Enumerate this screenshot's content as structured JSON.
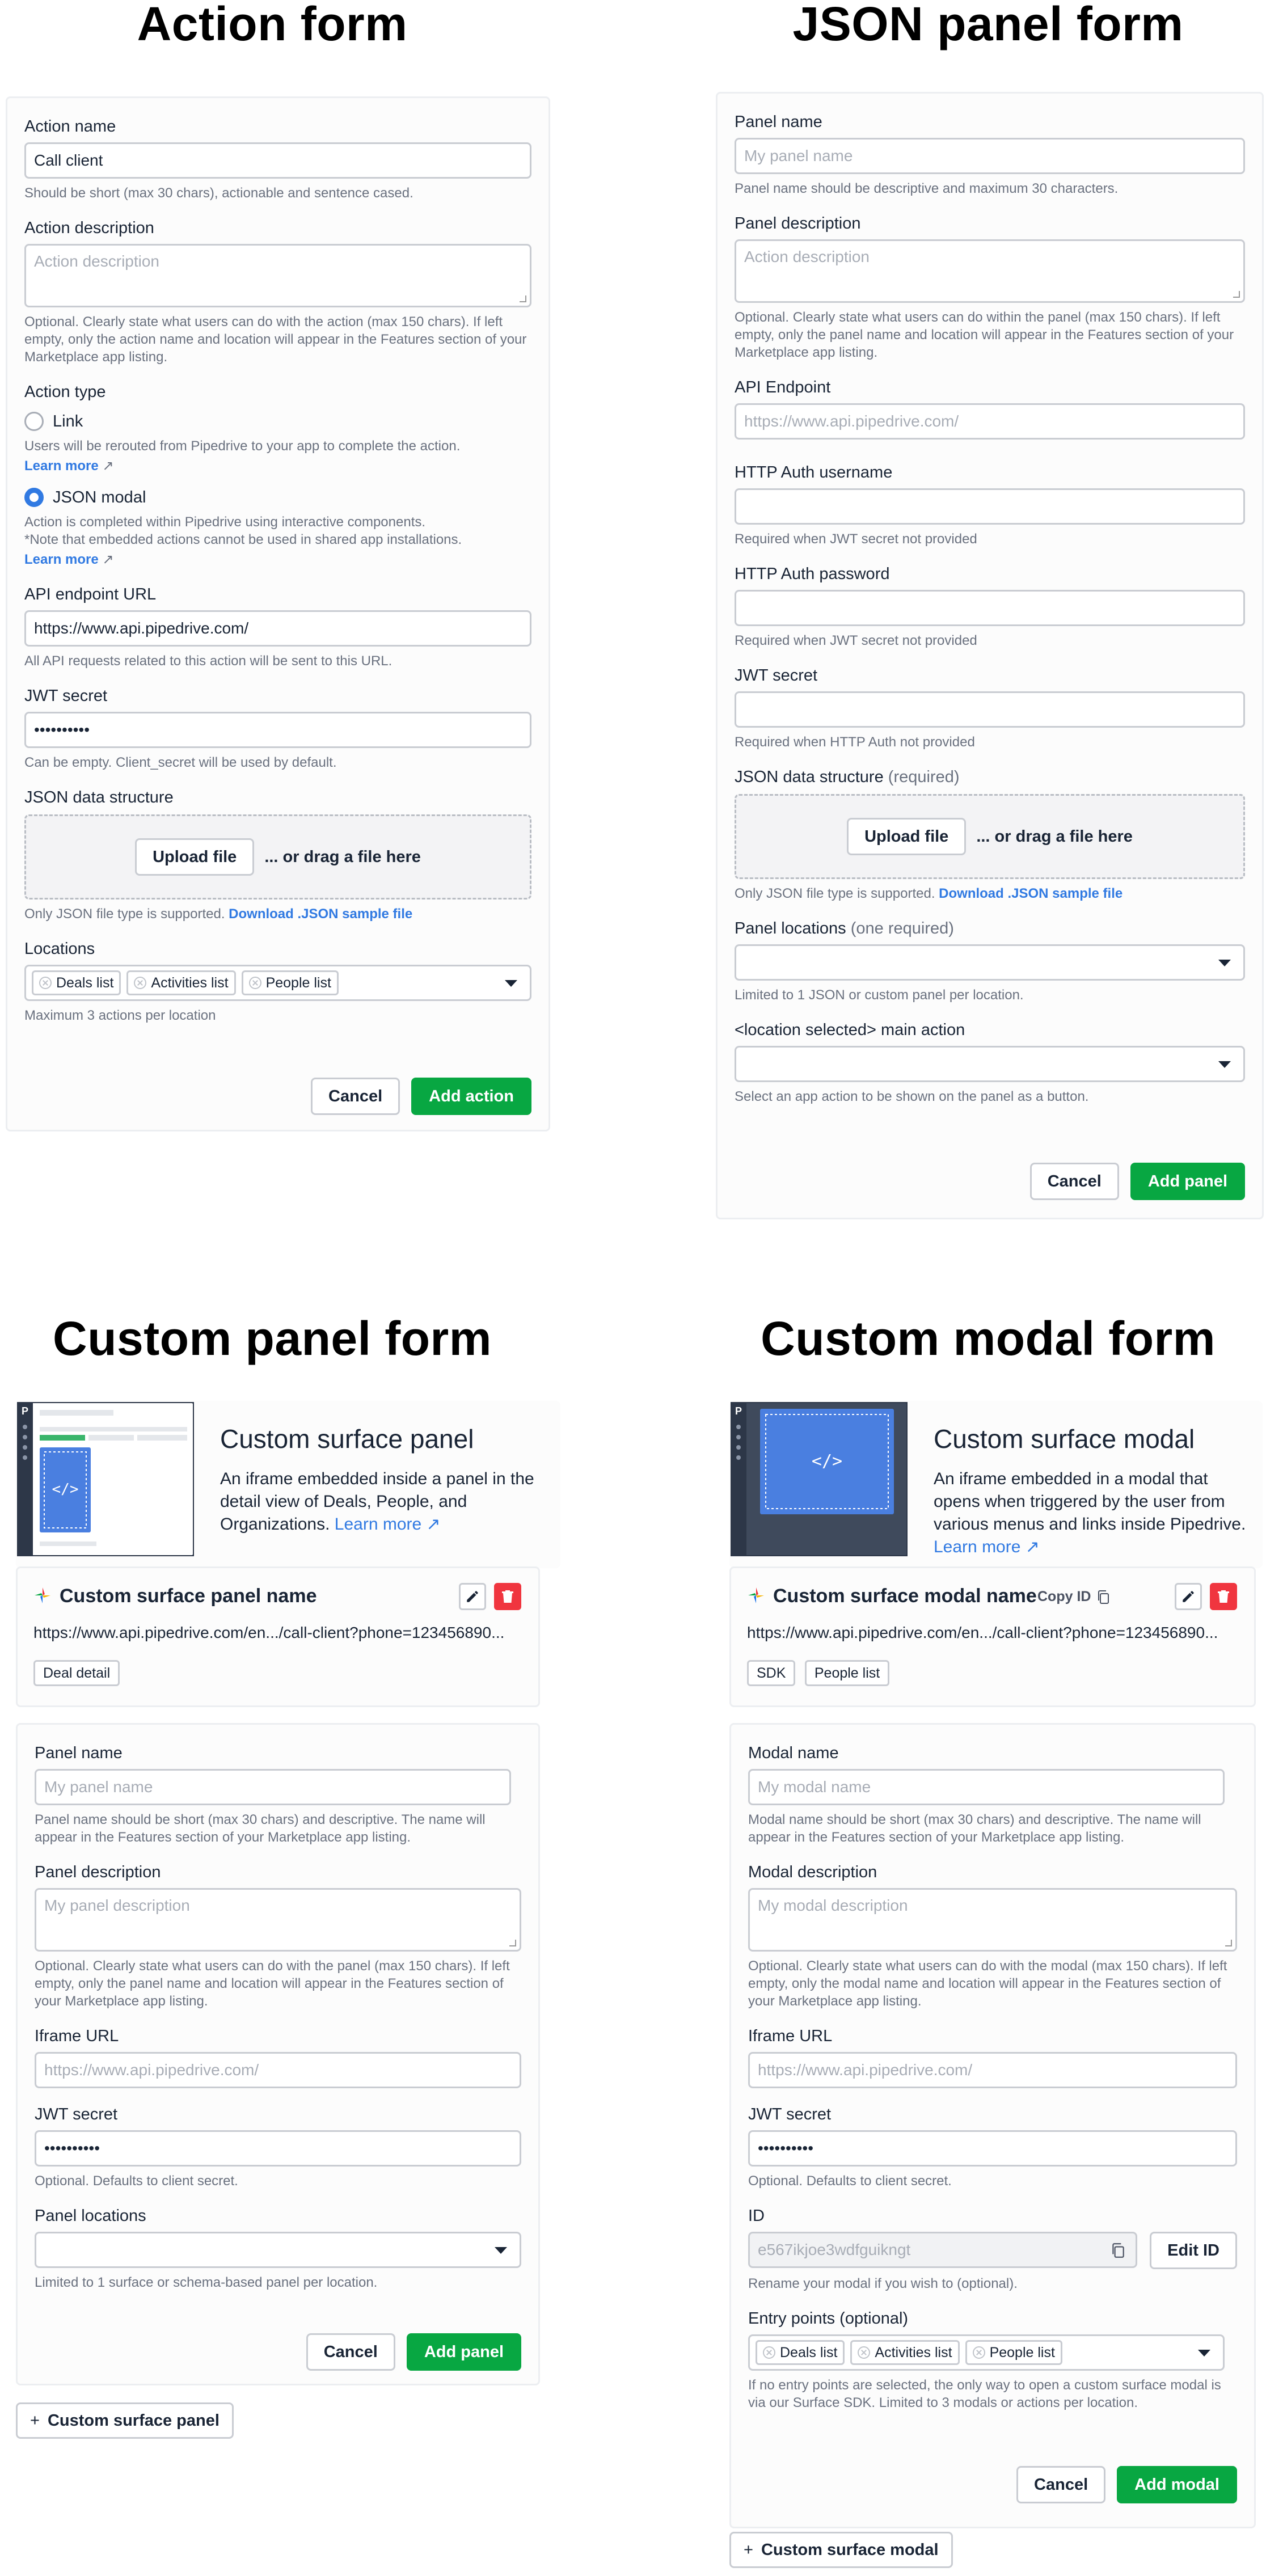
{
  "action_form": {
    "title": "Action form",
    "name_label": "Action name",
    "name_value": "Call client",
    "name_help": "Should be short (max 30 chars), actionable and sentence cased.",
    "desc_label": "Action description",
    "desc_placeholder": "Action description",
    "desc_help": "Optional. Clearly state what users can do with the action (max 150 chars). If left empty, only the action name and location will appear in the Features section of your Marketplace app listing.",
    "type_label": "Action type",
    "link_option": "Link",
    "link_help": "Users will be rerouted from Pipedrive to your app to complete the action.",
    "learn_more": "Learn more",
    "json_option": "JSON modal",
    "json_help": "Action is completed within Pipedrive using interactive components.",
    "json_note": "*Note that embedded actions cannot be used in shared app installations.",
    "api_label": "API endpoint URL",
    "api_value": "https://www.api.pipedrive.com/",
    "api_help": "All API requests related to this action will be sent to this URL.",
    "jwt_label": "JWT secret",
    "jwt_value": "••••••••••",
    "jwt_help": "Can be empty. Client_secret will be used by default.",
    "json_label": "JSON data structure",
    "upload": "Upload file",
    "drag": "... or drag a file here",
    "json_support": "Only JSON file type is supported.",
    "download": "Download .JSON sample file",
    "locations_label": "Locations",
    "locations": [
      "Deals list",
      "Activities list",
      "People list"
    ],
    "locations_help": "Maximum 3 actions per location",
    "cancel": "Cancel",
    "submit": "Add action"
  },
  "json_panel_form": {
    "title": "JSON panel form",
    "name_label": "Panel name",
    "name_placeholder": "My panel name",
    "name_help": "Panel name should be descriptive and maximum 30 characters.",
    "desc_label": "Panel description",
    "desc_placeholder": "Action description",
    "desc_help": "Optional. Clearly state what users can do within the panel (max 150 chars). If left empty, only the panel name and location will appear in the Features section of your Marketplace app listing.",
    "api_label": "API Endpoint",
    "api_placeholder": "https://www.api.pipedrive.com/",
    "user_label": "HTTP Auth username",
    "user_help": "Required when JWT secret not provided",
    "pass_label": "HTTP Auth password",
    "pass_help": "Required when JWT secret not provided",
    "jwt_label": "JWT secret",
    "jwt_help": "Required when HTTP Auth not provided",
    "json_label": "JSON data structure",
    "json_req": "(required)",
    "upload": "Upload file",
    "drag": "... or drag a file here",
    "json_support": "Only JSON file type is supported.",
    "download": "Download .JSON sample file",
    "loc_label": "Panel locations",
    "loc_req": "(one required)",
    "loc_help": "Limited to 1 JSON or custom panel per location.",
    "main_label": "<location selected> main action",
    "main_help": "Select an app action to be shown on the panel as a button.",
    "cancel": "Cancel",
    "submit": "Add panel"
  },
  "custom_panel_form": {
    "title": "Custom panel form",
    "surface_title": "Custom surface panel",
    "surface_desc": "An iframe embedded inside a panel in the detail view of Deals, People, and Organizations.",
    "learn_more": "Learn more",
    "card_name": "Custom surface panel name",
    "card_url": "https://www.api.pipedrive.com/en.../call-client?phone=123456890...",
    "card_tags": [
      "Deal detail"
    ],
    "name_label": "Panel name",
    "name_placeholder": "My panel name",
    "name_help": "Panel name should be short (max 30 chars) and descriptive. The name will appear in the Features section of your Marketplace app listing.",
    "desc_label": "Panel description",
    "desc_placeholder": "My panel description",
    "desc_help": "Optional. Clearly state what users can do with the panel (max 150 chars). If left empty, only the panel name and location will appear in the Features section of your Marketplace app listing.",
    "iframe_label": "Iframe URL",
    "iframe_placeholder": "https://www.api.pipedrive.com/",
    "jwt_label": "JWT secret",
    "jwt_value": "••••••••••",
    "jwt_help": "Optional. Defaults to client secret.",
    "loc_label": "Panel locations",
    "loc_help": "Limited to 1 surface or schema-based panel per location.",
    "cancel": "Cancel",
    "submit": "Add panel",
    "add_more": "Custom surface panel"
  },
  "custom_modal_form": {
    "title": "Custom modal form",
    "surface_title": "Custom surface modal",
    "surface_desc": "An iframe embedded in a modal that opens when triggered by the user from various menus and links inside Pipedrive.",
    "learn_more": "Learn more",
    "card_name": "Custom surface modal name",
    "copy_id": "Copy ID",
    "card_url": "https://www.api.pipedrive.com/en.../call-client?phone=123456890...",
    "card_tags": [
      "SDK",
      "People list"
    ],
    "name_label": "Modal name",
    "name_placeholder": "My modal name",
    "name_help": "Modal name should be short (max 30 chars) and descriptive. The name will appear in the Features section of your Marketplace app listing.",
    "desc_label": "Modal description",
    "desc_placeholder": "My modal description",
    "desc_help": "Optional. Clearly state what users can do with the modal (max 150 chars). If left empty, only the modal name and location will appear in the Features section of your Marketplace app listing.",
    "iframe_label": "Iframe URL",
    "iframe_placeholder": "https://www.api.pipedrive.com/",
    "jwt_label": "JWT secret",
    "jwt_value": "••••••••••",
    "jwt_help": "Optional. Defaults to client secret.",
    "id_label": "ID",
    "id_value": "e567ikjoe3wdfguikngt",
    "edit_id": "Edit ID",
    "id_help": "Rename your modal if you wish to (optional).",
    "entry_label": "Entry points (optional)",
    "entry_points": [
      "Deals list",
      "Activities list",
      "People list"
    ],
    "entry_help": "If no entry points are selected, the only way to open a custom surface modal is via our Surface SDK. Limited to 3 modals or actions per location.",
    "cancel": "Cancel",
    "submit": "Add modal",
    "add_more": "Custom surface modal"
  },
  "colors": {
    "primary": "#08a742",
    "link": "#317ae2",
    "danger": "#f0353f",
    "thumb_dark": "#2d3748",
    "thumb_blue": "#4a7fe0"
  }
}
